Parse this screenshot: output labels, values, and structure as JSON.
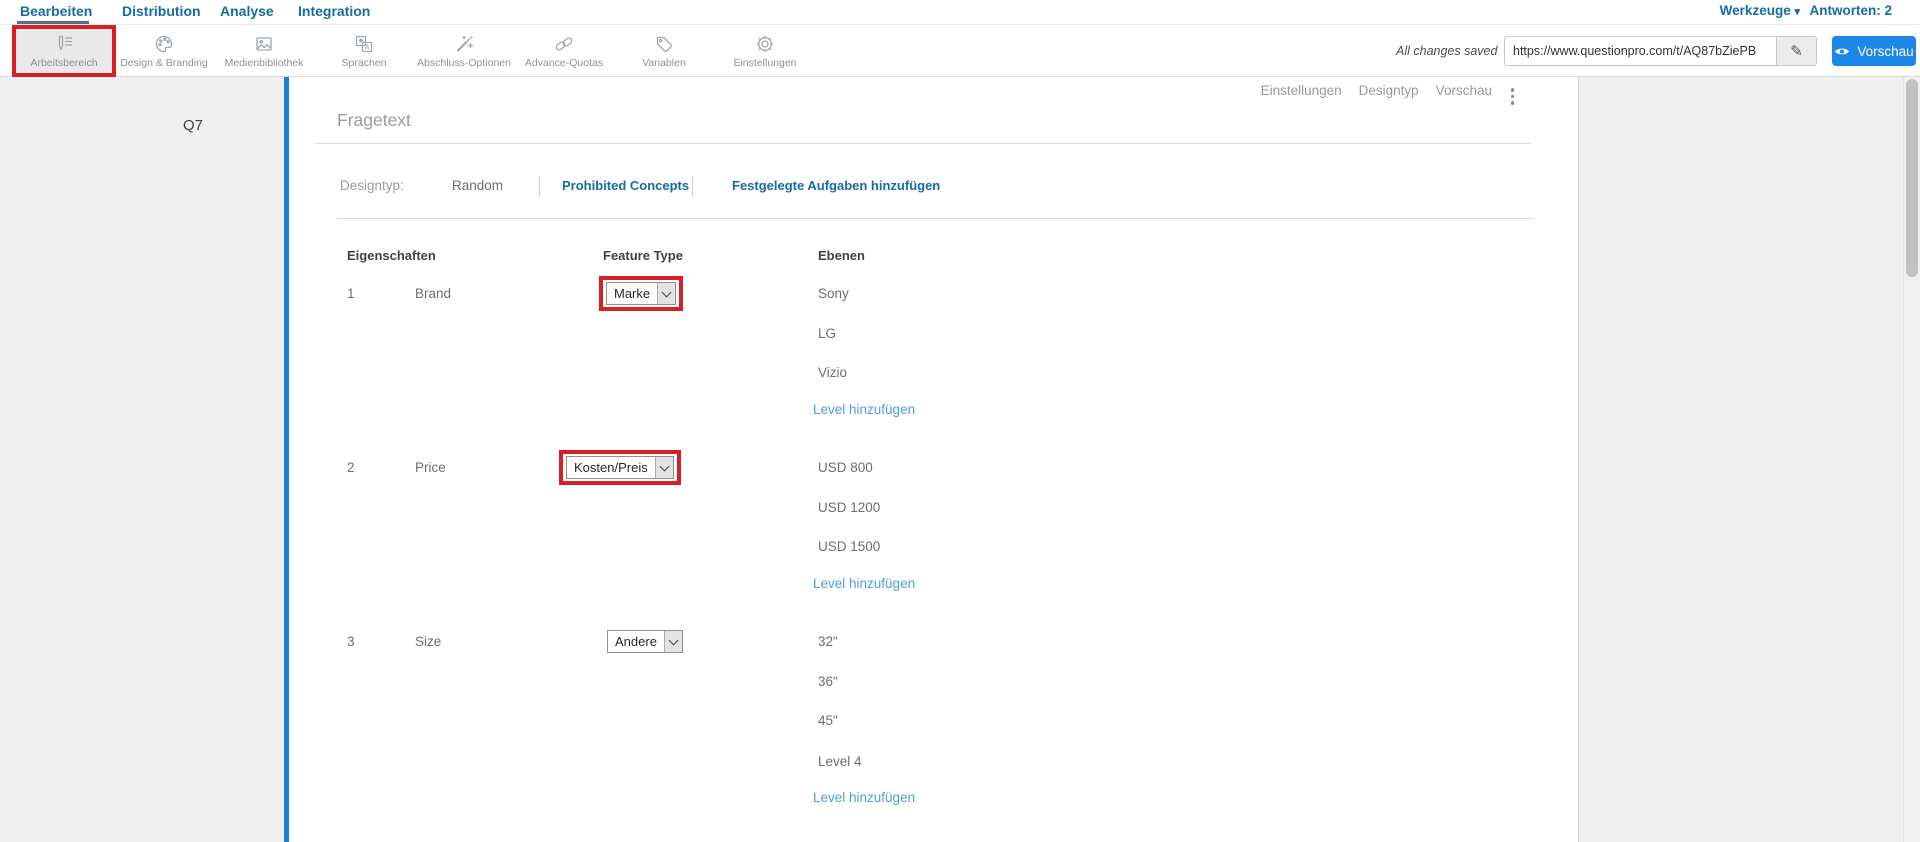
{
  "top_nav": {
    "items": [
      {
        "label": "Bearbeiten",
        "active": true
      },
      {
        "label": "Distribution",
        "active": false
      },
      {
        "label": "Analyse",
        "active": false
      },
      {
        "label": "Integration",
        "active": false
      }
    ],
    "werkzeuge_label": "Werkzeuge",
    "antworten_label": "Antworten: 2"
  },
  "toolbar": {
    "items": [
      {
        "label": "Arbeitsbereich",
        "icon": "workspace-icon",
        "active": true,
        "highlighted_red": true
      },
      {
        "label": "Design & Branding",
        "icon": "palette-icon"
      },
      {
        "label": "Medienbibliothek",
        "icon": "media-library-icon"
      },
      {
        "label": "Sprachen",
        "icon": "languages-icon"
      },
      {
        "label": "Abschluss-Optionen",
        "icon": "wand-icon"
      },
      {
        "label": "Advance-Quotas",
        "icon": "chain-icon"
      },
      {
        "label": "Variablen",
        "icon": "tag-icon"
      },
      {
        "label": "Einstellungen",
        "icon": "gear-icon"
      }
    ],
    "save_status": "All changes saved",
    "survey_url": "https://www.questionpro.com/t/AQ87bZiePB",
    "preview_button": "Vorschau"
  },
  "sidebar": {
    "question_id": "Q7"
  },
  "content": {
    "header_menu": {
      "items": [
        "Einstellungen",
        "Designtyp",
        "Vorschau"
      ]
    },
    "question_text_placeholder": "Fragetext",
    "design_row": {
      "label": "Designtyp:",
      "value": "Random",
      "link_prohibited": "Prohibited Concepts",
      "link_fixed_tasks": "Festgelegte Aufgaben hinzufügen"
    },
    "table": {
      "col_eigenschaften": "Eigenschaften",
      "col_feature_type": "Feature Type",
      "col_ebenen": "Ebenen",
      "add_level_label": "Level hinzufügen",
      "rows": [
        {
          "num": "1",
          "name": "Brand",
          "feature_type": "Marke",
          "highlighted_red": true,
          "levels": [
            "Sony",
            "LG",
            "Vizio"
          ]
        },
        {
          "num": "2",
          "name": "Price",
          "feature_type": "Kosten/Preis",
          "highlighted_red": true,
          "levels": [
            "USD 800",
            "USD 1200",
            "USD 1500"
          ]
        },
        {
          "num": "3",
          "name": "Size",
          "feature_type": "Andere",
          "highlighted_red": false,
          "levels": [
            "32\"",
            "36\"",
            "45\"",
            "Level 4"
          ]
        }
      ]
    }
  },
  "colors": {
    "accent_blue": "#1b87e6",
    "nav_blue": "#176ba5",
    "highlight_red": "#d91f26",
    "light_link_blue": "#4e9fd6",
    "left_bar_blue": "#1b7fd4"
  }
}
